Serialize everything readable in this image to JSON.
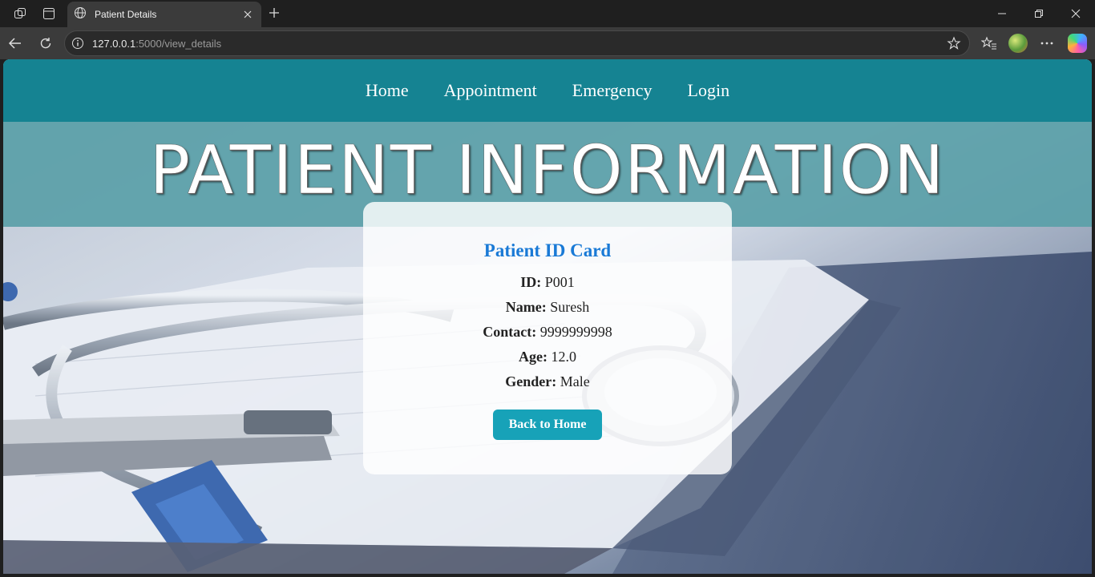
{
  "browser": {
    "tab_title": "Patient Details",
    "url_host": "127.0.0.1",
    "url_rest": ":5000/view_details"
  },
  "nav": {
    "items": [
      "Home",
      "Appointment",
      "Emergency",
      "Login"
    ]
  },
  "banner": {
    "title": "PATIENT INFORMATION"
  },
  "card": {
    "title": "Patient ID Card",
    "fields": [
      {
        "label": "ID:",
        "value": "P001"
      },
      {
        "label": "Name:",
        "value": "Suresh"
      },
      {
        "label": "Contact:",
        "value": "9999999998"
      },
      {
        "label": "Age:",
        "value": "12.0"
      },
      {
        "label": "Gender:",
        "value": "Male"
      }
    ],
    "button": "Back to Home"
  },
  "colors": {
    "navbar": "#158392",
    "title": "#1a7ad6",
    "button": "#17a2b8"
  }
}
